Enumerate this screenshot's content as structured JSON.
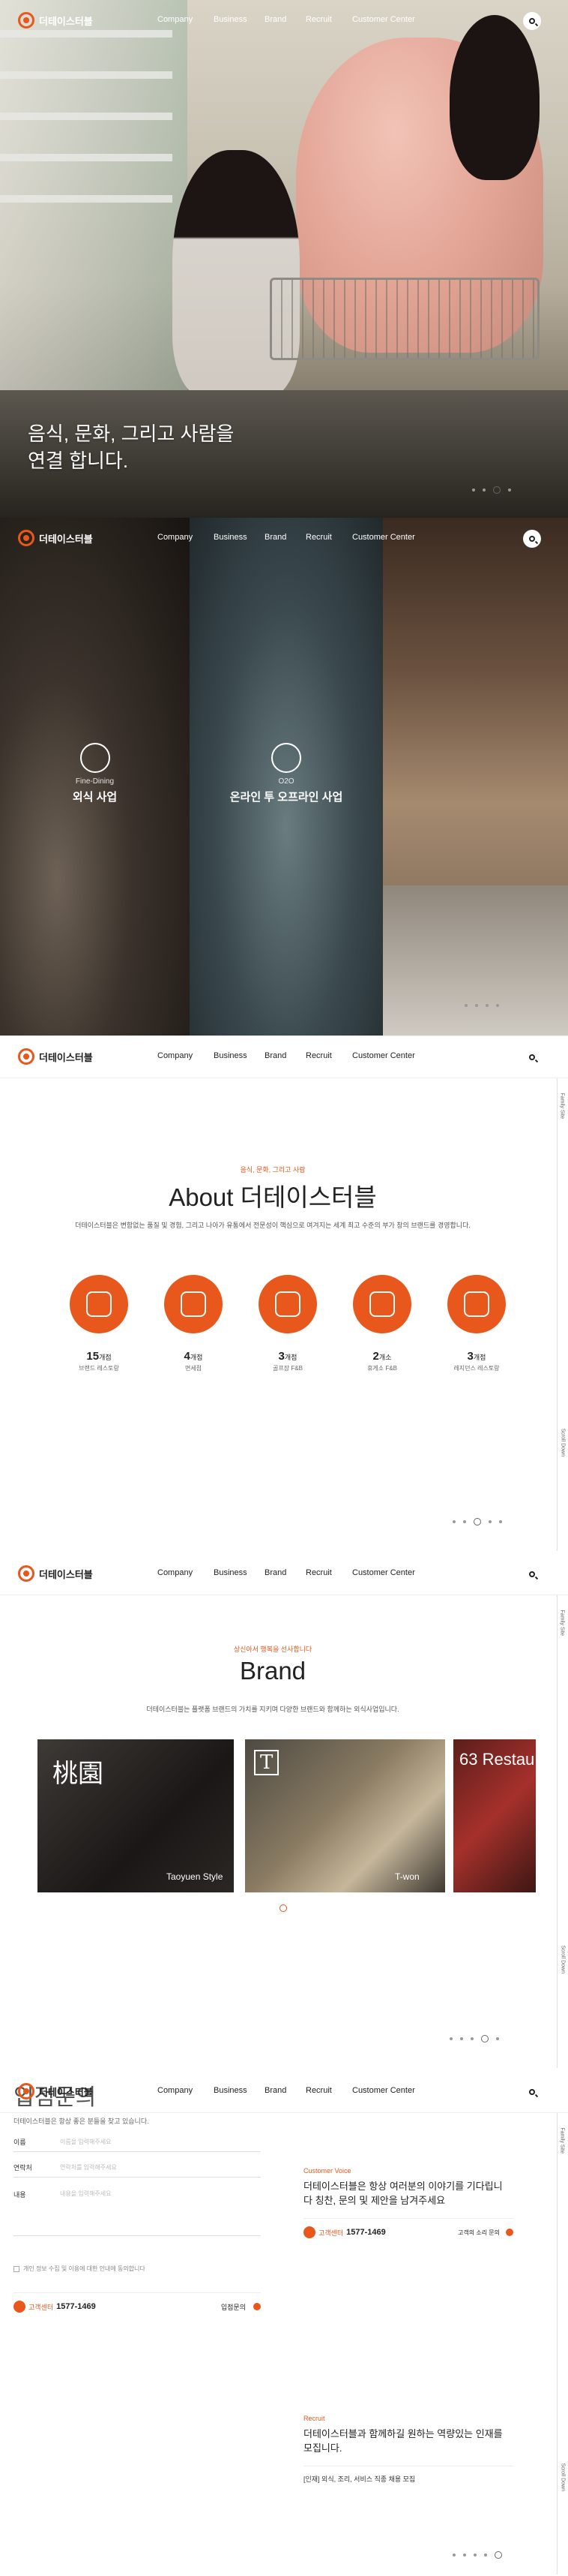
{
  "brand": {
    "name": "더테이스터블",
    "accent": "#e8571b"
  },
  "nav": {
    "items": [
      "Company",
      "Business",
      "Brand",
      "Recruit",
      "Customer Center"
    ]
  },
  "hero": {
    "line1": "음식, 문화, 그리고 사람을",
    "line2": "연결 합니다."
  },
  "business": {
    "panels": [
      {
        "sub": "Fine-Dining",
        "title": "외식 사업"
      },
      {
        "sub": "O2O",
        "title": "온라인 투 오프라인 사업"
      },
      {
        "sub": "",
        "title": ""
      }
    ]
  },
  "about": {
    "kicker": "음식, 문화, 그리고 사람",
    "title": "About 더테이스터블",
    "desc": "더테이스터블은 변함없는 품질 및 경험, 그리고 나아가 유통에서 전문성이 핵심으로 여겨지는 세계 최고 수준의 부가 창의 브랜드를 경영합니다.",
    "stats": [
      {
        "num": "15",
        "unit": "개점",
        "label": "브랜드 레스토랑"
      },
      {
        "num": "4",
        "unit": "개점",
        "label": "면세점"
      },
      {
        "num": "3",
        "unit": "개점",
        "label": "골프장 F&B"
      },
      {
        "num": "2",
        "unit": "개소",
        "label": "휴게소 F&B"
      },
      {
        "num": "3",
        "unit": "개점",
        "label": "레지던스 레스토랑"
      }
    ]
  },
  "brand_section": {
    "kicker": "상신아서 행복을 선사합니다",
    "title": "Brand",
    "desc": "더테이스터블는 플랫폼 브랜드의 가치를 지키며 다양한 브랜드와 함께하는 외식사업입니다.",
    "cards": [
      {
        "big": "桃園",
        "caption": "Taoyuen Style"
      },
      {
        "big": "T",
        "caption": "T-won"
      },
      {
        "big": "63 Restau",
        "caption": ""
      }
    ]
  },
  "contact": {
    "title": "입점문의",
    "desc": "더테이스터블은 항상 좋은 분들을 찾고 있습니다.",
    "fields": [
      {
        "label": "이름",
        "placeholder": "이름을 입력해주세요"
      },
      {
        "label": "연락처",
        "placeholder": "연락처를 입력해주세요"
      },
      {
        "label": "내용",
        "placeholder": "내용을 입력해주세요"
      }
    ],
    "agree": "개인 정보 수집 및 이용에 대한 안내에 동의합니다",
    "phone_label": "고객센터",
    "phone": "1577-1469",
    "submit": "입점문의",
    "voice_kicker": "Customer Voice",
    "voice_title": "더테이스터블은 항상 여러분의 이야기를 기다립니다 칭찬, 문의 및 제안을 남겨주세요",
    "voice_link": "고객의 소리 문의",
    "recruit_kicker": "Recruit",
    "recruit_title": "더테이스터블과 함께하길 원하는 역량있는 인재를 모집니다.",
    "recruit_item": "[인재] 외식, 조리, 서비스 직종 채용 모집"
  },
  "rail": {
    "family": "Family Site",
    "scroll": "Scroll Down"
  }
}
